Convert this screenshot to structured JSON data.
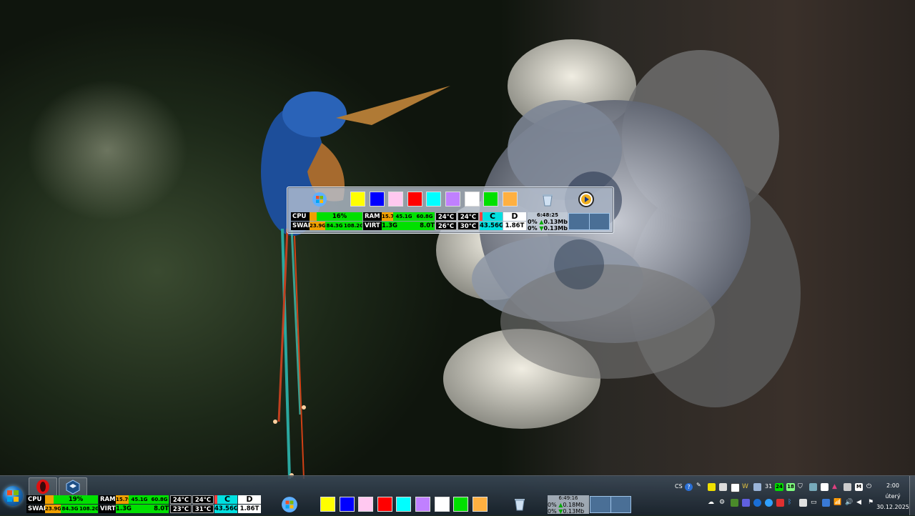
{
  "palette": [
    "#ffff00",
    "#0000ff",
    "#ffc8f0",
    "#ff0000",
    "#00ffff",
    "#c080ff",
    "#ffffff",
    "#00e000",
    "#ffb040"
  ],
  "widget": {
    "cpu_label": "CPU",
    "cpu_value": "16%",
    "swap_label": "SWAP",
    "swap_values": [
      "23.9G",
      "84.3G",
      "108.2G"
    ],
    "ram_label": "RAM",
    "ram_values": [
      "15.7G",
      "45.1G",
      "60.8G"
    ],
    "virt_label": "VIRT",
    "virt_values": [
      "1.3G",
      "8.0T"
    ],
    "temps_top": [
      "24°C",
      "24°C"
    ],
    "temps_bottom": [
      "26°C",
      "30°C"
    ],
    "drive_c": "C",
    "drive_c_size": "43.56G",
    "drive_d": "D",
    "drive_d_size": "1.86T",
    "net_time": "6:48:25",
    "net_up": "0%",
    "net_up_rate": "0.13Mb",
    "net_down": "0%",
    "net_down_rate": "0.13Mb"
  },
  "taskbar": {
    "cpu_label": "CPU",
    "cpu_value": "19%",
    "swap_label": "SWAP",
    "swap_values": [
      "23.9G",
      "84.3G",
      "108.2G"
    ],
    "ram_label": "RAM",
    "ram_values": [
      "15.7G",
      "45.1G",
      "60.8G"
    ],
    "virt_label": "VIRT",
    "virt_values": [
      "1.3G",
      "8.0T"
    ],
    "temps_top": [
      "24°C",
      "24°C"
    ],
    "temps_bottom": [
      "23°C",
      "31°C"
    ],
    "drive_c": "C",
    "drive_c_size": "43.56G",
    "drive_d": "D",
    "drive_d_size": "1.86T",
    "net_time": "6:49:16",
    "net_up": "0%",
    "net_up_rate": "0.18Mb",
    "net_down": "0%",
    "net_down_rate": "0.13Mb"
  },
  "tray": {
    "language": "CS",
    "calendar_day": "31",
    "badge_a": "24",
    "badge_b": "18",
    "clock_time": "2:00",
    "clock_day": "úterý",
    "clock_date": "30.12.2025"
  }
}
